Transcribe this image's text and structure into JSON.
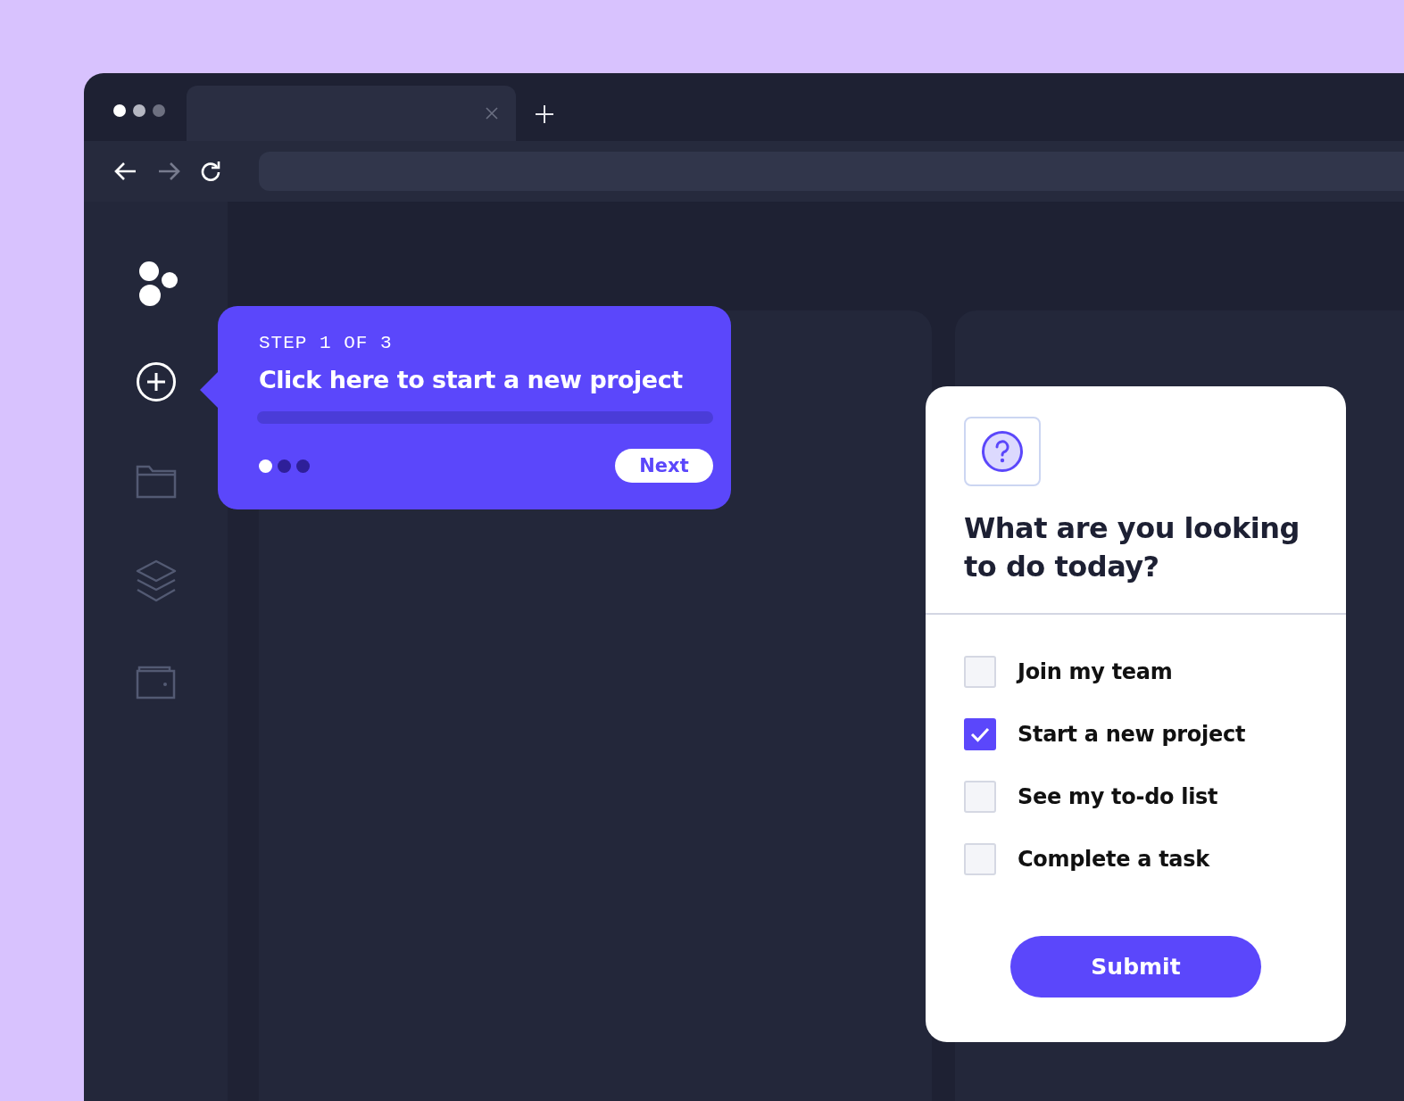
{
  "sidebar": {
    "items": [
      {
        "kind": "add",
        "selected": true
      },
      {
        "kind": "folder",
        "selected": false
      },
      {
        "kind": "layers",
        "selected": false
      },
      {
        "kind": "wallet",
        "selected": false
      }
    ]
  },
  "tour": {
    "step_label": "STEP 1 OF 3",
    "message": "Click here to start a new project",
    "steps": [
      {
        "selected": true
      },
      {
        "selected": false
      },
      {
        "selected": false
      }
    ],
    "next_button": "Next"
  },
  "survey": {
    "question": "What are you looking to do today?",
    "options": [
      {
        "label": "Join my team",
        "checked": false
      },
      {
        "label": "Start a new project",
        "checked": true
      },
      {
        "label": "See my to-do list",
        "checked": false
      },
      {
        "label": "Complete a task",
        "checked": false
      }
    ],
    "submit_button": "Submit"
  }
}
